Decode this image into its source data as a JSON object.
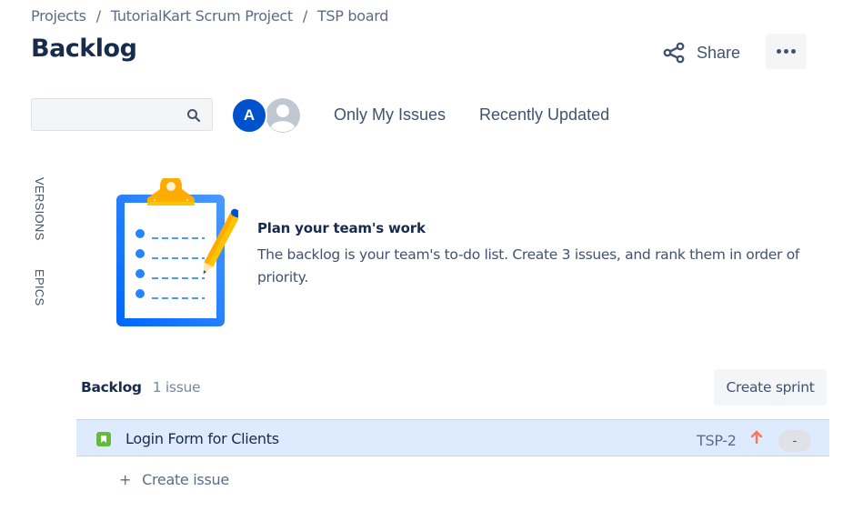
{
  "breadcrumb": [
    {
      "label": "Projects"
    },
    {
      "label": "TutorialKart Scrum Project"
    },
    {
      "label": "TSP board"
    }
  ],
  "breadcrumb_separator": "/",
  "page_title": "Backlog",
  "header_actions": {
    "share_label": "Share",
    "share_icon": "share-icon",
    "more_icon": "more-horizontal-icon"
  },
  "toolbar": {
    "search": {
      "value": "",
      "placeholder": "",
      "icon": "search-icon"
    },
    "avatars": [
      {
        "initial": "A",
        "color": "#0052cc"
      },
      {
        "initial": "",
        "icon": "default-user-icon",
        "color": "#c1c7d0"
      }
    ],
    "quick_filters": [
      "Only My Issues",
      "Recently Updated"
    ]
  },
  "side_tabs": [
    "VERSIONS",
    "EPICS"
  ],
  "empty_state": {
    "illustration": "clipboard-with-pencil",
    "title": "Plan your team's work",
    "text": "The backlog is your team's to-do list. Create 3 issues, and rank them in order of priority."
  },
  "backlog": {
    "title": "Backlog",
    "count_label": "1 issue",
    "create_sprint_label": "Create sprint",
    "issues": [
      {
        "type": "story",
        "type_color": "#63ba3c",
        "summary": "Login Form for Clients",
        "key": "TSP-2",
        "priority": "high",
        "priority_color": "#ff7452",
        "estimate": "-"
      }
    ],
    "create_issue_icon": "+",
    "create_issue_label": "Create issue"
  },
  "colors": {
    "selected_row": "#deebff",
    "primary_text": "#172b4d",
    "secondary_text": "#5e6c84"
  }
}
